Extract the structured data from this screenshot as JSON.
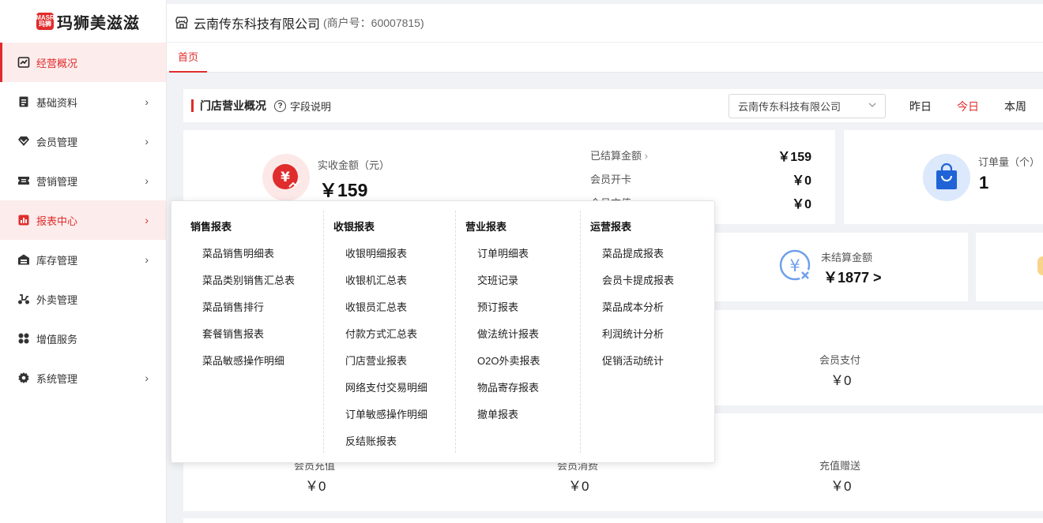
{
  "app": {
    "logo_badge": "MASR\n玛狮",
    "logo_text": "玛狮美滋滋"
  },
  "sidebar": {
    "items": [
      {
        "label": "经营概况",
        "icon": "trend-chart-icon"
      },
      {
        "label": "基础资料",
        "icon": "document-icon"
      },
      {
        "label": "会员管理",
        "icon": "diamond-icon"
      },
      {
        "label": "营销管理",
        "icon": "ticket-icon"
      },
      {
        "label": "报表中心",
        "icon": "bar-chart-icon"
      },
      {
        "label": "库存管理",
        "icon": "warehouse-icon"
      },
      {
        "label": "外卖管理",
        "icon": "scooter-icon"
      },
      {
        "label": "增值服务",
        "icon": "apps-icon"
      },
      {
        "label": "系统管理",
        "icon": "gear-icon"
      }
    ],
    "arrow": "›"
  },
  "header": {
    "company": "云南传东科技有限公司",
    "merchant": "(商户号：60007815)"
  },
  "tabs": [
    {
      "label": "首页"
    }
  ],
  "section": {
    "title": "门店营业概况",
    "help": "字段说明",
    "store_select": "云南传东科技有限公司",
    "dates": [
      "昨日",
      "今日",
      "本周"
    ],
    "selected_date": "今日"
  },
  "stats": {
    "received_label": "实收金额（元）",
    "received_value": "￥159",
    "settled_label": "已结算金额",
    "settled_value": "￥159",
    "member_card_label": "会员开卡",
    "member_card_value": "￥0",
    "member_recharge_label": "会员充值",
    "member_recharge_value": "￥0",
    "orders_label": "订单量（个）",
    "orders_value": "1",
    "unsettled_label": "未结算金额",
    "unsettled_value": "￥1877 >",
    "member_pay_label": "会员支付",
    "member_pay_value": "￥0",
    "recharge_label": "会员充值",
    "recharge_value": "￥0",
    "consume_label": "会员消费",
    "consume_value": "￥0",
    "gift_label": "充值赠送",
    "gift_value": "￥0"
  },
  "reports": {
    "sales": {
      "title": "销售报表",
      "items": [
        "菜品销售明细表",
        "菜品类别销售汇总表",
        "菜品销售排行",
        "套餐销售报表",
        "菜品敏感操作明细"
      ]
    },
    "cashier": {
      "title": "收银报表",
      "items": [
        "收银明细报表",
        "收银机汇总表",
        "收银员汇总表",
        "付款方式汇总表",
        "门店营业报表",
        "网络支付交易明细",
        "订单敏感操作明细",
        "反结账报表"
      ]
    },
    "business": {
      "title": "营业报表",
      "items": [
        "订单明细表",
        "交班记录",
        "预订报表",
        "做法统计报表",
        "O2O外卖报表",
        "物品寄存报表",
        "撤单报表"
      ]
    },
    "operation": {
      "title": "运营报表",
      "items": [
        "菜品提成报表",
        "会员卡提成报表",
        "菜品成本分析",
        "利润统计分析",
        "促销活动统计"
      ]
    }
  },
  "colors": {
    "accent": "#e02c2c",
    "accent_light": "#fdecec",
    "blue": "#1f63d6"
  }
}
